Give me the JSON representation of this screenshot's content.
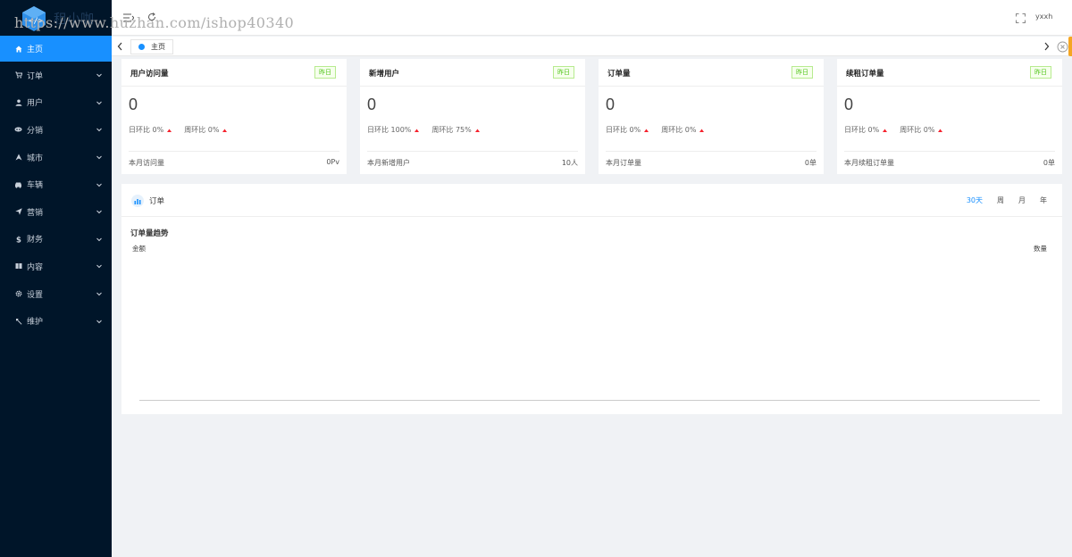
{
  "watermark": "https://www.huzhan.com/ishop40340",
  "logo": {
    "text": "租小咖"
  },
  "sidebar": {
    "items": [
      {
        "label": "主页",
        "icon": "home-icon",
        "active": true
      },
      {
        "label": "订单",
        "icon": "cart-icon"
      },
      {
        "label": "用户",
        "icon": "user-icon"
      },
      {
        "label": "分销",
        "icon": "share-icon"
      },
      {
        "label": "城市",
        "icon": "location-icon"
      },
      {
        "label": "车辆",
        "icon": "car-icon"
      },
      {
        "label": "营销",
        "icon": "send-icon"
      },
      {
        "label": "财务",
        "icon": "dollar-icon"
      },
      {
        "label": "内容",
        "icon": "book-icon"
      },
      {
        "label": "设置",
        "icon": "gear-icon"
      },
      {
        "label": "维护",
        "icon": "wrench-icon"
      }
    ]
  },
  "header": {
    "username": "yxxh"
  },
  "tabs": {
    "items": [
      {
        "label": "主页"
      }
    ]
  },
  "cards": [
    {
      "title": "用户访问量",
      "tag": "昨日",
      "value": "0",
      "trend1": "日环比 0%",
      "trend2": "周环比 0%",
      "foot_label": "本月访问量",
      "foot_value": "0Pv"
    },
    {
      "title": "新增用户",
      "tag": "昨日",
      "value": "0",
      "trend1": "日环比 100%",
      "trend2": "周环比 75%",
      "foot_label": "本月新增用户",
      "foot_value": "10人"
    },
    {
      "title": "订单量",
      "tag": "昨日",
      "value": "0",
      "trend1": "日环比 0%",
      "trend2": "周环比 0%",
      "foot_label": "本月订单量",
      "foot_value": "0单"
    },
    {
      "title": "续租订单量",
      "tag": "昨日",
      "value": "0",
      "trend1": "日环比 0%",
      "trend2": "周环比 0%",
      "foot_label": "本月续租订单量",
      "foot_value": "0单"
    }
  ],
  "orders": {
    "title": "订单",
    "filters": [
      "30天",
      "周",
      "月",
      "年"
    ],
    "active_filter": "30天",
    "chart_title": "订单量趋势",
    "axis_left": "金额",
    "axis_right": "数量"
  },
  "colors": {
    "sidebar_bg": "#001529",
    "accent": "#1890ff",
    "tag_green": "#52c41a",
    "trend_red": "#f5222d"
  }
}
